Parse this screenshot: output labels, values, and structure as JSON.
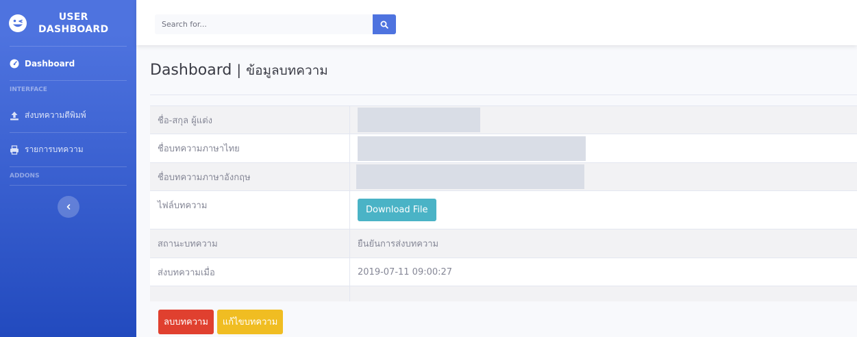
{
  "sidebar": {
    "brand_line1": "USER",
    "brand_line2": "DASHBOARD",
    "items": [
      {
        "label": "Dashboard",
        "icon": "tachometer-icon"
      },
      {
        "label": "ส่งบทความตีพิมพ์",
        "icon": "upload-icon"
      },
      {
        "label": "รายการบทความ",
        "icon": "print-icon"
      }
    ],
    "headings": [
      "INTERFACE",
      "ADDONS"
    ]
  },
  "search": {
    "placeholder": "Search for..."
  },
  "page": {
    "title_main": "Dashboard",
    "title_sep": "|",
    "title_sub": "ข้อมูลบทความ"
  },
  "table": {
    "rows": [
      {
        "label": "ชื่อ-สกุล ผู้แต่ง",
        "value": ""
      },
      {
        "label": "ชื่อบทความภาษาไทย",
        "value": ""
      },
      {
        "label": "ชื่อบทความภาษาอังกฤษ",
        "value": ""
      },
      {
        "label": "ไฟล์บทความ",
        "value": "Download File"
      },
      {
        "label": "สถานะบทความ",
        "value": "ยืนยันการส่งบทความ"
      },
      {
        "label": "ส่งบทความเมื่อ",
        "value": "2019-07-11 09:00:27"
      },
      {
        "label": "",
        "value": ""
      }
    ]
  },
  "actions": {
    "delete_label": "ลบบทความ",
    "edit_label": "แก้ไขบทความ"
  },
  "colors": {
    "sidebar_top": "#4e73df",
    "sidebar_bottom": "#224abe",
    "delete": "#e0402f",
    "edit": "#f0bd22",
    "download": "#4ab3c6"
  }
}
